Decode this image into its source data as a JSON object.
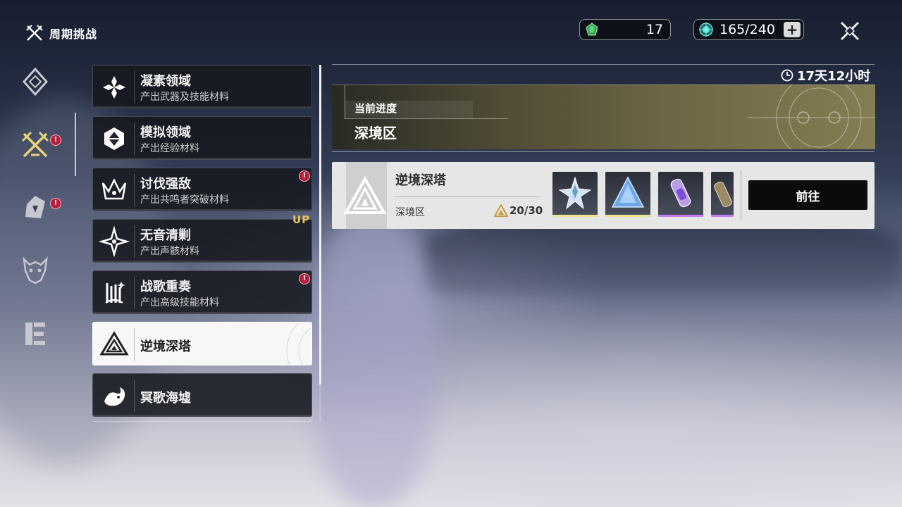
{
  "header": {
    "title": "周期挑战",
    "title_icon": "crossed-swords-icon",
    "currency1": {
      "icon": "green-crystal-icon",
      "value": "17"
    },
    "currency2": {
      "icon": "stamina-orb-icon",
      "value": "165/240",
      "add_label": "+"
    },
    "close_icon": "close-icon"
  },
  "left_nav": [
    {
      "icon": "diamond-emblem-icon",
      "badge": false
    },
    {
      "icon": "crossed-swords-gold-icon",
      "badge": true,
      "active": true
    },
    {
      "icon": "shield-star-icon",
      "badge": true
    },
    {
      "icon": "demon-mask-icon",
      "badge": false
    },
    {
      "icon": "scroll-banner-icon",
      "badge": false
    }
  ],
  "list": {
    "items": [
      {
        "name": "凝素领域",
        "sub": "产出武器及技能材料",
        "icon": "crystal-cluster-icon",
        "badge": ""
      },
      {
        "name": "模拟领域",
        "sub": "产出经验材料",
        "icon": "hex-gem-icon",
        "badge": ""
      },
      {
        "name": "讨伐强敌",
        "sub": "产出共鸣者突破材料",
        "icon": "crown-beast-icon",
        "badge": "!"
      },
      {
        "name": "无音清剿",
        "sub": "产出声骸材料",
        "icon": "four-point-star-icon",
        "badge": "",
        "tag": "UP"
      },
      {
        "name": "战歌重奏",
        "sub": "产出高级技能材料",
        "icon": "harp-rune-icon",
        "badge": "!"
      },
      {
        "name": "逆境深塔",
        "sub": "",
        "icon": "triangle-tower-icon",
        "badge": "",
        "selected": true
      },
      {
        "name": "冥歌海墟",
        "sub": "",
        "icon": "sea-serpent-icon",
        "badge": ""
      }
    ]
  },
  "panel": {
    "timer": "17天12小时",
    "timer_icon": "clock-icon",
    "progress_label": "当前进度",
    "progress_value": "深境区",
    "card": {
      "name": "逆境深塔",
      "zone": "深境区",
      "stars": "20/30",
      "emblem_icon": "triangle-tower-emblem-icon",
      "star_icon": "gold-triangle-star-icon",
      "rewards": [
        {
          "icon": "silver-star-shard-icon",
          "rarity_color": "#f0e58a"
        },
        {
          "icon": "blue-prism-icon",
          "rarity_color": "#f0e58a"
        },
        {
          "icon": "purple-tube-icon",
          "rarity_color": "#c77bff"
        },
        {
          "icon": "purple-vial-icon",
          "rarity_color": "#c77bff"
        }
      ],
      "go_label": "前往"
    }
  },
  "colors": {
    "accent_gold": "#e8c15a",
    "badge_red": "#b3203c",
    "panel_bg": "#e6e6e6"
  }
}
